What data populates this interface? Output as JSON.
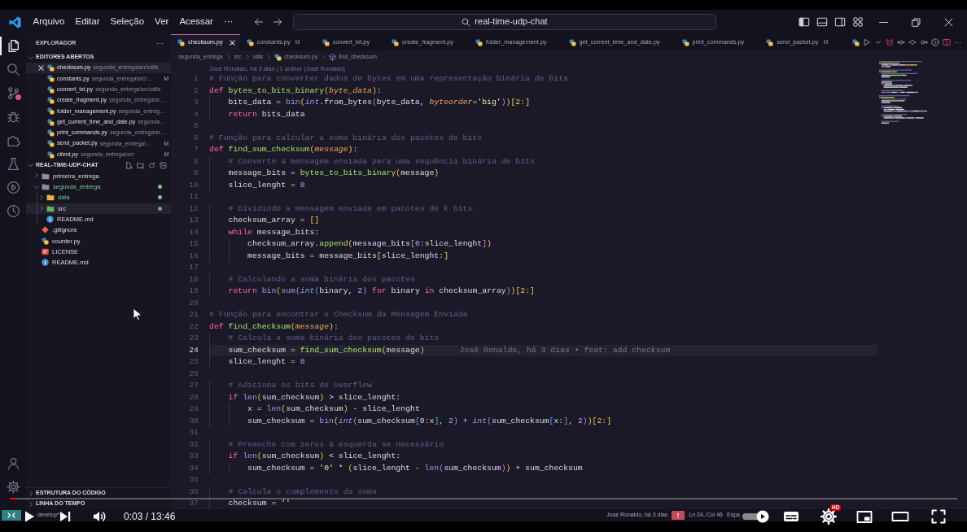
{
  "window": {
    "menu": [
      "Arquivo",
      "Editar",
      "Seleção",
      "Ver",
      "Acessar"
    ],
    "more": "···",
    "search": "real-time-udp-chat"
  },
  "activity_bar": {
    "items": [
      {
        "kind": "files",
        "selected": true,
        "badge": false
      },
      {
        "kind": "search",
        "selected": false,
        "badge": false
      },
      {
        "kind": "scm",
        "selected": false,
        "badge": true
      },
      {
        "kind": "debug",
        "selected": false,
        "badge": false
      },
      {
        "kind": "extensions",
        "selected": false,
        "badge": false
      },
      {
        "kind": "testing",
        "selected": false,
        "badge": false
      },
      {
        "kind": "remote",
        "selected": false,
        "badge": false
      },
      {
        "kind": "timeline",
        "selected": false,
        "badge": false
      }
    ]
  },
  "sidebar": {
    "title": "EXPLORADOR",
    "more": "···",
    "open_editors": {
      "title": "EDITORES ABERTOS",
      "expanded": true,
      "items": [
        {
          "name": "checksum.py",
          "path": "segunda_entrega\\src\\utils",
          "selected": true,
          "preview": false
        },
        {
          "name": "constants.py",
          "path": "segunda_entrega\\src\\…",
          "status": "M",
          "selected": false,
          "preview": false
        },
        {
          "name": "convert_txt.py",
          "path": "segunda_entrega\\src\\utils",
          "selected": false,
          "preview": false
        },
        {
          "name": "create_fragment.py",
          "path": "segunda_entrega\\sr…",
          "selected": false,
          "preview": false
        },
        {
          "name": "folder_management.py",
          "path": "segunda_entreg…",
          "selected": false,
          "preview": false
        },
        {
          "name": "get_current_time_and_date.py",
          "path": "segunda…",
          "selected": false,
          "preview": false
        },
        {
          "name": "print_commands.py",
          "path": "segunda_entrega\\sr…",
          "selected": false,
          "preview": false
        },
        {
          "name": "send_packet.py",
          "path": "segunda_entrega\\…",
          "status": "M",
          "selected": false,
          "preview": false
        },
        {
          "name": "client.py",
          "path": "segunda_entrega\\src",
          "status": "M",
          "selected": false,
          "preview": true
        }
      ]
    },
    "project": {
      "title": "REAL-TIME-UDP-CHAT",
      "expanded": true,
      "tree": [
        {
          "name": "primeira_entrega",
          "kind": "folder",
          "expanded": false,
          "selected": false,
          "dot": false
        },
        {
          "name": "segunda_entrega",
          "kind": "folder",
          "expanded": true,
          "selected": false,
          "dot": true,
          "color": "#73c991",
          "children": [
            {
              "name": "data",
              "kind": "datafolder",
              "expanded": false,
              "selected": false,
              "dot": true,
              "color": "#73c991"
            },
            {
              "name": "src",
              "kind": "srcfolder",
              "expanded": false,
              "selected": true,
              "dot": true
            },
            {
              "name": "README.md",
              "kind": "readme",
              "selected": false,
              "dot": false
            }
          ]
        },
        {
          "name": ".gitignore",
          "kind": "git",
          "selected": false,
          "dot": false
        },
        {
          "name": "counter.py",
          "kind": "python",
          "selected": false,
          "dot": false
        },
        {
          "name": "LICENSE",
          "kind": "license",
          "selected": false,
          "dot": false
        },
        {
          "name": "README.md",
          "kind": "readme",
          "selected": false,
          "dot": false
        }
      ]
    },
    "panels": [
      {
        "title": "ESTRUTURA DO CÓDIGO",
        "expanded": false
      },
      {
        "title": "LINHA DO TEMPO",
        "expanded": false
      }
    ]
  },
  "editor": {
    "tabs": [
      {
        "name": "checksum.py",
        "selected": true
      },
      {
        "name": "constants.py",
        "status": "M",
        "selected": false
      },
      {
        "name": "convert_txt.py",
        "selected": false
      },
      {
        "name": "create_fragment.py",
        "selected": false
      },
      {
        "name": "folder_management.py",
        "selected": false
      },
      {
        "name": "get_current_time_and_date.py",
        "selected": false
      },
      {
        "name": "print_commands.py",
        "selected": false
      },
      {
        "name": "send_packet.py",
        "status": "M",
        "selected": false
      }
    ],
    "more": "···",
    "breadcrumb": [
      {
        "kind": "folder",
        "text": "segunda_entrega"
      },
      {
        "kind": "folder",
        "text": "src"
      },
      {
        "kind": "folder",
        "text": "utils"
      },
      {
        "kind": "file",
        "text": "checksum.py"
      },
      {
        "kind": "symbol",
        "text": "find_checksum"
      }
    ],
    "code_lens": "José Ronaldo, há 3 dias | 1 author (José Ronaldo)",
    "lines": [
      {
        "number": "1",
        "current": false,
        "tokens": [
          {
            "kind": "comment",
            "text": "# Função para converter dados de bytes em uma representação binária de bits"
          }
        ]
      },
      {
        "number": "2",
        "current": false,
        "tokens": [
          {
            "kind": "keyword",
            "text": "def "
          },
          {
            "kind": "function",
            "text": "bytes_to_bits_binary"
          },
          {
            "kind": "bracket1",
            "text": "("
          },
          {
            "kind": "param",
            "text": "byte_data"
          },
          {
            "kind": "bracket1",
            "text": ")"
          },
          {
            "kind": "plain",
            "text": ":"
          }
        ]
      },
      {
        "number": "3",
        "current": false,
        "tokens": [
          {
            "kind": "plain",
            "text": "    bits_data = "
          },
          {
            "kind": "builtin",
            "text": "bin"
          },
          {
            "kind": "bracket1",
            "text": "("
          },
          {
            "kind": "type",
            "text": "int"
          },
          {
            "kind": "plain",
            "text": ".from_bytes"
          },
          {
            "kind": "bracket2",
            "text": "("
          },
          {
            "kind": "plain",
            "text": "byte_data, "
          },
          {
            "kind": "param",
            "text": "byteorder"
          },
          {
            "kind": "plain",
            "text": "="
          },
          {
            "kind": "string",
            "text": "'big'"
          },
          {
            "kind": "bracket2",
            "text": ")"
          },
          {
            "kind": "bracket1",
            "text": ")[2:]"
          }
        ]
      },
      {
        "number": "4",
        "current": false,
        "tokens": [
          {
            "kind": "keyword",
            "text": "    return"
          },
          {
            "kind": "plain",
            "text": " bits_data"
          }
        ]
      },
      {
        "number": "5",
        "current": false
      },
      {
        "number": "6",
        "current": false,
        "tokens": [
          {
            "kind": "comment",
            "text": "# Função para calcular a soma binária dos pacotes de bits"
          }
        ]
      },
      {
        "number": "7",
        "current": false,
        "tokens": [
          {
            "kind": "keyword",
            "text": "def "
          },
          {
            "kind": "function",
            "text": "find_sum_checksum"
          },
          {
            "kind": "bracket1",
            "text": "("
          },
          {
            "kind": "param",
            "text": "message"
          },
          {
            "kind": "bracket1",
            "text": ")"
          },
          {
            "kind": "plain",
            "text": ":"
          }
        ]
      },
      {
        "number": "8",
        "current": false,
        "tokens": [
          {
            "kind": "comment",
            "text": "    # Converte a mensagem enviada para uma sequência binária de bits"
          }
        ]
      },
      {
        "number": "9",
        "current": false,
        "tokens": [
          {
            "kind": "plain",
            "text": "    message_bits = "
          },
          {
            "kind": "function",
            "text": "bytes_to_bits_binary"
          },
          {
            "kind": "bracket1",
            "text": "("
          },
          {
            "kind": "plain",
            "text": "message"
          },
          {
            "kind": "bracket1",
            "text": ")"
          }
        ]
      },
      {
        "number": "10",
        "current": false,
        "tokens": [
          {
            "kind": "plain",
            "text": "    slice_lenght = "
          },
          {
            "kind": "number",
            "text": "8"
          }
        ]
      },
      {
        "number": "11",
        "current": false
      },
      {
        "number": "12",
        "current": false,
        "tokens": [
          {
            "kind": "comment",
            "text": "    # Dividindo a mensagem enviada em pacotes de k bits."
          }
        ]
      },
      {
        "number": "13",
        "current": false,
        "tokens": [
          {
            "kind": "plain",
            "text": "    checksum_array = "
          },
          {
            "kind": "bracket1",
            "text": "[]"
          }
        ]
      },
      {
        "number": "14",
        "current": false,
        "tokens": [
          {
            "kind": "keyword",
            "text": "    while"
          },
          {
            "kind": "plain",
            "text": " message_bits:"
          }
        ]
      },
      {
        "number": "15",
        "current": false,
        "tokens": [
          {
            "kind": "plain",
            "text": "        checksum_array."
          },
          {
            "kind": "function",
            "text": "append"
          },
          {
            "kind": "bracket1",
            "text": "("
          },
          {
            "kind": "plain",
            "text": "message_bits"
          },
          {
            "kind": "bracket2",
            "text": "["
          },
          {
            "kind": "number",
            "text": "0"
          },
          {
            "kind": "plain",
            "text": ":slice_lenght"
          },
          {
            "kind": "bracket2",
            "text": "]"
          },
          {
            "kind": "bracket1",
            "text": ")"
          }
        ]
      },
      {
        "number": "16",
        "current": false,
        "tokens": [
          {
            "kind": "plain",
            "text": "        message_bits = message_bits"
          },
          {
            "kind": "bracket1",
            "text": "["
          },
          {
            "kind": "plain",
            "text": "slice_lenght:"
          },
          {
            "kind": "bracket1",
            "text": "]"
          }
        ]
      },
      {
        "number": "17",
        "current": false
      },
      {
        "number": "18",
        "current": false,
        "tokens": [
          {
            "kind": "comment",
            "text": "    # Calculando a soma binária dos pacotes"
          }
        ]
      },
      {
        "number": "19",
        "current": false,
        "tokens": [
          {
            "kind": "keyword",
            "text": "    return"
          },
          {
            "kind": "builtin",
            "text": " bin"
          },
          {
            "kind": "bracket1",
            "text": "("
          },
          {
            "kind": "builtin",
            "text": "sum"
          },
          {
            "kind": "bracket2",
            "text": "("
          },
          {
            "kind": "type",
            "text": "int"
          },
          {
            "kind": "bracket3",
            "text": "("
          },
          {
            "kind": "plain",
            "text": "binary, "
          },
          {
            "kind": "number",
            "text": "2"
          },
          {
            "kind": "bracket3",
            "text": ")"
          },
          {
            "kind": "keyword",
            "text": " for"
          },
          {
            "kind": "plain",
            "text": " binary "
          },
          {
            "kind": "keyword",
            "text": "in"
          },
          {
            "kind": "plain",
            "text": " checksum_array"
          },
          {
            "kind": "bracket2",
            "text": ")"
          },
          {
            "kind": "bracket1",
            "text": ")[2:]"
          }
        ]
      },
      {
        "number": "20",
        "current": false
      },
      {
        "number": "21",
        "current": false,
        "tokens": [
          {
            "kind": "comment",
            "text": "# Função para encontrar o Checksum da Mensagem Enviada"
          }
        ]
      },
      {
        "number": "22",
        "current": false,
        "tokens": [
          {
            "kind": "keyword",
            "text": "def "
          },
          {
            "kind": "function",
            "text": "find_checksum"
          },
          {
            "kind": "bracket1",
            "text": "("
          },
          {
            "kind": "param",
            "text": "message"
          },
          {
            "kind": "bracket1",
            "text": ")"
          },
          {
            "kind": "plain",
            "text": ":"
          }
        ]
      },
      {
        "number": "23",
        "current": false,
        "tokens": [
          {
            "kind": "comment",
            "text": "    # Calcula a soma binária dos pacotes de bits"
          }
        ]
      },
      {
        "number": "24",
        "current": true,
        "tokens": [
          {
            "kind": "plain",
            "text": "    sum_checksum = "
          },
          {
            "kind": "function",
            "text": "find_sum_checksum"
          },
          {
            "kind": "bracket1",
            "text": "("
          },
          {
            "kind": "plain",
            "text": "message"
          },
          {
            "kind": "bracket1",
            "text": ")"
          }
        ],
        "blame": "José Ronaldo, há 3 dias • feat: add checksum"
      },
      {
        "number": "25",
        "current": false,
        "tokens": [
          {
            "kind": "plain",
            "text": "    slice_lenght = "
          },
          {
            "kind": "number",
            "text": "8"
          }
        ]
      },
      {
        "number": "26",
        "current": false
      },
      {
        "number": "27",
        "current": false,
        "tokens": [
          {
            "kind": "comment",
            "text": "    # Adiciona os bits de overflow"
          }
        ]
      },
      {
        "number": "28",
        "current": false,
        "tokens": [
          {
            "kind": "keyword",
            "text": "    if"
          },
          {
            "kind": "builtin",
            "text": " len"
          },
          {
            "kind": "bracket1",
            "text": "("
          },
          {
            "kind": "plain",
            "text": "sum_checksum"
          },
          {
            "kind": "bracket1",
            "text": ")"
          },
          {
            "kind": "plain",
            "text": " > slice_lenght:"
          }
        ]
      },
      {
        "number": "29",
        "current": false,
        "tokens": [
          {
            "kind": "plain",
            "text": "        x = "
          },
          {
            "kind": "builtin",
            "text": "len"
          },
          {
            "kind": "bracket1",
            "text": "("
          },
          {
            "kind": "plain",
            "text": "sum_checksum"
          },
          {
            "kind": "bracket1",
            "text": ")"
          },
          {
            "kind": "plain",
            "text": " - slice_lenght"
          }
        ]
      },
      {
        "number": "30",
        "current": false,
        "tokens": [
          {
            "kind": "plain",
            "text": "        sum_checksum = "
          },
          {
            "kind": "builtin",
            "text": "bin"
          },
          {
            "kind": "bracket1",
            "text": "("
          },
          {
            "kind": "type",
            "text": "int"
          },
          {
            "kind": "bracket2",
            "text": "("
          },
          {
            "kind": "plain",
            "text": "sum_checksum"
          },
          {
            "kind": "bracket3",
            "text": "["
          },
          {
            "kind": "plain",
            "text": "0:x"
          },
          {
            "kind": "bracket3",
            "text": "]"
          },
          {
            "kind": "plain",
            "text": ", "
          },
          {
            "kind": "number",
            "text": "2"
          },
          {
            "kind": "bracket2",
            "text": ")"
          },
          {
            "kind": "plain",
            "text": " + "
          },
          {
            "kind": "type",
            "text": "int"
          },
          {
            "kind": "bracket2",
            "text": "("
          },
          {
            "kind": "plain",
            "text": "sum_checksum"
          },
          {
            "kind": "bracket3",
            "text": "["
          },
          {
            "kind": "plain",
            "text": "x:"
          },
          {
            "kind": "bracket3",
            "text": "]"
          },
          {
            "kind": "plain",
            "text": ", "
          },
          {
            "kind": "number",
            "text": "2"
          },
          {
            "kind": "bracket2",
            "text": ")"
          },
          {
            "kind": "bracket1",
            "text": ")[2:]"
          }
        ]
      },
      {
        "number": "31",
        "current": false
      },
      {
        "number": "32",
        "current": false,
        "tokens": [
          {
            "kind": "comment",
            "text": "    # Preenche com zeros à esquerda se necessário"
          }
        ]
      },
      {
        "number": "33",
        "current": false,
        "tokens": [
          {
            "kind": "keyword",
            "text": "    if"
          },
          {
            "kind": "builtin",
            "text": " len"
          },
          {
            "kind": "bracket1",
            "text": "("
          },
          {
            "kind": "plain",
            "text": "sum_checksum"
          },
          {
            "kind": "bracket1",
            "text": ")"
          },
          {
            "kind": "plain",
            "text": " < slice_lenght:"
          }
        ]
      },
      {
        "number": "34",
        "current": false,
        "tokens": [
          {
            "kind": "plain",
            "text": "        sum_checksum = "
          },
          {
            "kind": "string",
            "text": "'0'"
          },
          {
            "kind": "plain",
            "text": " * "
          },
          {
            "kind": "bracket1",
            "text": "("
          },
          {
            "kind": "plain",
            "text": "slice_lenght - "
          },
          {
            "kind": "builtin",
            "text": "len"
          },
          {
            "kind": "bracket2",
            "text": "("
          },
          {
            "kind": "plain",
            "text": "sum_checksum"
          },
          {
            "kind": "bracket2",
            "text": ")"
          },
          {
            "kind": "bracket1",
            "text": ")"
          },
          {
            "kind": "plain",
            "text": " + sum_checksum"
          }
        ]
      },
      {
        "number": "35",
        "current": false
      },
      {
        "number": "36",
        "current": false,
        "tokens": [
          {
            "kind": "comment",
            "text": "    # Calcula o complemento da soma"
          }
        ]
      },
      {
        "number": "37",
        "current": false,
        "tokens": [
          {
            "kind": "plain",
            "text": "    checksum = "
          },
          {
            "kind": "string",
            "text": "''"
          }
        ]
      }
    ]
  },
  "status_bar": {
    "branch": "develop*",
    "blame": "José Ronaldo, há 3 dias",
    "cursor": "Ln 24, Col 46",
    "indentation": "Espa"
  },
  "player": {
    "progress": {
      "level": 0.006
    },
    "time": "0:03 / 13:46",
    "autoplay": {
      "on": true
    },
    "quality": "HD"
  }
}
